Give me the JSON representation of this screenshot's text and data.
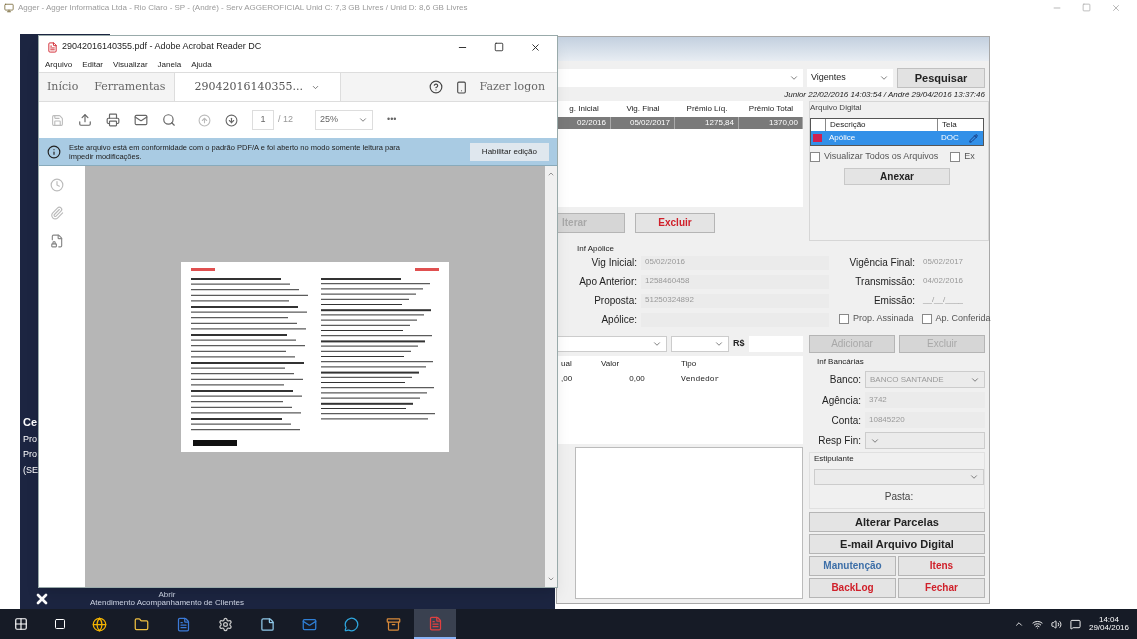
{
  "os_window": {
    "title": "Agger - Agger Informatica Ltda - Rio Claro - SP - (André) - Serv AGGEROFICIAL Unid C: 7,3 GB Livres / Unid D: 8,6 GB Livres"
  },
  "desktop": {
    "side_texts": [
      "Ce",
      "Pro",
      "Pro",
      "(SE"
    ],
    "open_button": "Abrir",
    "footer_caption": "Atendimento Acompanhamento de Clientes"
  },
  "form": {
    "filter": "Vigentes",
    "search_button": "Pesquisar",
    "audit": "Junior 22/02/2016 14:03:54 / André 29/04/2016 13:37:46",
    "policies": {
      "columns": [
        "g. Inicial",
        "Vig. Final",
        "Prêmio Líq.",
        "Prêmio Total"
      ],
      "rows": [
        {
          "cells": [
            "02/2016",
            "05/02/2017",
            "1275,84",
            "1370,00"
          ],
          "selected": true
        }
      ]
    },
    "policy_buttons": [
      {
        "label": "lterar",
        "disabled": true
      },
      {
        "label": "Excluir",
        "color": "#d0202a",
        "disabled": false
      }
    ],
    "digital_files": {
      "title": "Arquivo Digital",
      "columns": [
        "Descrição",
        "Tela"
      ],
      "rows": [
        {
          "description": "Apólice",
          "screen": "DOC",
          "selected": true
        }
      ],
      "options": [
        {
          "label": "Visualizar Todos os Arquivos",
          "checked": false
        },
        {
          "label": "Ex",
          "checked": false
        }
      ],
      "button": "Anexar"
    },
    "policy_info": {
      "title": "Inf Apólice",
      "left": [
        {
          "label": "Vig Inicial:",
          "value": "05/02/2016"
        },
        {
          "label": "Apo Anterior:",
          "value": "1258460458"
        },
        {
          "label": "Proposta:",
          "value": "51250324892"
        },
        {
          "label": "Apólice:"
        }
      ],
      "right": [
        {
          "label": "Vigência Final:",
          "value": "05/02/2017"
        },
        {
          "label": "Transmissão:",
          "value": "04/02/2016"
        },
        {
          "label": "Emissão:",
          "value": "__/__/____"
        }
      ],
      "checks": [
        {
          "label": "Prop. Assinada",
          "checked": false
        },
        {
          "label": "Ap. Conferida",
          "checked": false
        }
      ]
    },
    "installment_entry": {
      "currency": "R$",
      "buttons": [
        {
          "label": "Adicionar",
          "disabled": true
        },
        {
          "label": "Excluir",
          "disabled": true
        }
      ]
    },
    "installments": {
      "columns": [
        "ual",
        "Valor",
        "Tipo"
      ],
      "rows": [
        {
          "cells": [
            ",00",
            "0,00",
            "Vendedor"
          ],
          "selected": false
        }
      ]
    },
    "bank_info": {
      "title": "Inf Bancárias",
      "fields": [
        {
          "label": "Banco:",
          "value": "BANCO SANTANDE",
          "kind": "select"
        },
        {
          "label": "Agência:",
          "value": "3742",
          "kind": "text"
        },
        {
          "label": "Conta:",
          "value": "10845220",
          "kind": "text"
        },
        {
          "label": "Resp Fin:",
          "kind": "select"
        }
      ]
    },
    "stipulator": {
      "title": "Estipulante"
    },
    "folder_label": "Pasta:",
    "actions": [
      {
        "label": "Alterar Parcelas",
        "color": "#222222",
        "kind": "wide"
      },
      {
        "label": "E-mail Arquivo Digital",
        "color": "#222222",
        "kind": "wide"
      },
      {
        "label": "Manutenção",
        "color": "#3d6fa8",
        "kind": "half"
      },
      {
        "label": "Itens",
        "color": "#d0202a",
        "kind": "half"
      },
      {
        "label": "BackLog",
        "color": "#d0202a",
        "kind": "half"
      },
      {
        "label": "Fechar",
        "color": "#d0202a",
        "kind": "half"
      }
    ]
  },
  "reader": {
    "title": "29042016140355.pdf - Adobe Acrobat Reader DC",
    "menu": [
      "Arquivo",
      "Editar",
      "Visualizar",
      "Janela",
      "Ajuda"
    ],
    "tabs": [
      {
        "label": "Início",
        "selected": false
      },
      {
        "label": "Ferramentas",
        "selected": false
      },
      {
        "label": "29042016140355...",
        "selected": true
      }
    ],
    "sign_in": "Fazer logon",
    "page": "1",
    "page_count": "/ 12",
    "zoom": "25%",
    "more": "•••",
    "notice": "Este arquivo está em conformidade com o padrão PDF/A e foi aberto no modo somente leitura para impedir modificações.",
    "notice_button": "Habilitar edição"
  },
  "taskbar": {
    "apps": [
      {
        "kind": "browser",
        "active": false
      },
      {
        "kind": "folder",
        "active": false
      },
      {
        "kind": "document",
        "active": false
      },
      {
        "kind": "gear",
        "active": false
      },
      {
        "kind": "notepad",
        "active": false
      },
      {
        "kind": "mail",
        "active": false
      },
      {
        "kind": "chat",
        "active": false
      },
      {
        "kind": "archive",
        "active": false
      },
      {
        "kind": "pdf",
        "active": true
      }
    ],
    "clock": {
      "time": "14:04",
      "date": "29/04/2016"
    }
  }
}
